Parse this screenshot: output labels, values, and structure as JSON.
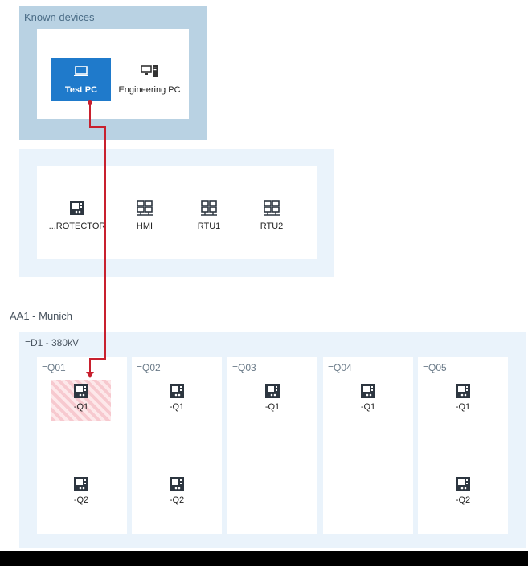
{
  "known_devices": {
    "title": "Known devices",
    "items": [
      {
        "label": "Test PC",
        "icon": "laptop-icon",
        "selected": true
      },
      {
        "label": "Engineering PC",
        "icon": "workstation-icon",
        "selected": false
      }
    ]
  },
  "device_group": {
    "items": [
      {
        "label": "...ROTECTOR",
        "icon": "ied-icon"
      },
      {
        "label": "HMI",
        "icon": "network-node-icon"
      },
      {
        "label": "RTU1",
        "icon": "network-node-icon"
      },
      {
        "label": "RTU2",
        "icon": "network-node-icon"
      }
    ]
  },
  "site": {
    "label": "AA1 - Munich",
    "voltage_level": {
      "label": "=D1 - 380kV",
      "bays": [
        {
          "label": "=Q01",
          "ieds": [
            "-Q1",
            "-Q2"
          ]
        },
        {
          "label": "=Q02",
          "ieds": [
            "-Q1",
            "-Q2"
          ]
        },
        {
          "label": "=Q03",
          "ieds": [
            "-Q1"
          ]
        },
        {
          "label": "=Q04",
          "ieds": [
            "-Q1"
          ]
        },
        {
          "label": "=Q05",
          "ieds": [
            "-Q1",
            "-Q2"
          ]
        }
      ]
    }
  },
  "connection": {
    "from": "Test PC",
    "to": "=Q01 -Q1",
    "color": "#c8202e"
  },
  "colors": {
    "selected": "#1f7acb",
    "known_panel": "#b9d2e3",
    "light_panel": "#eaf3fb",
    "hatch": "#f7c9cf"
  }
}
